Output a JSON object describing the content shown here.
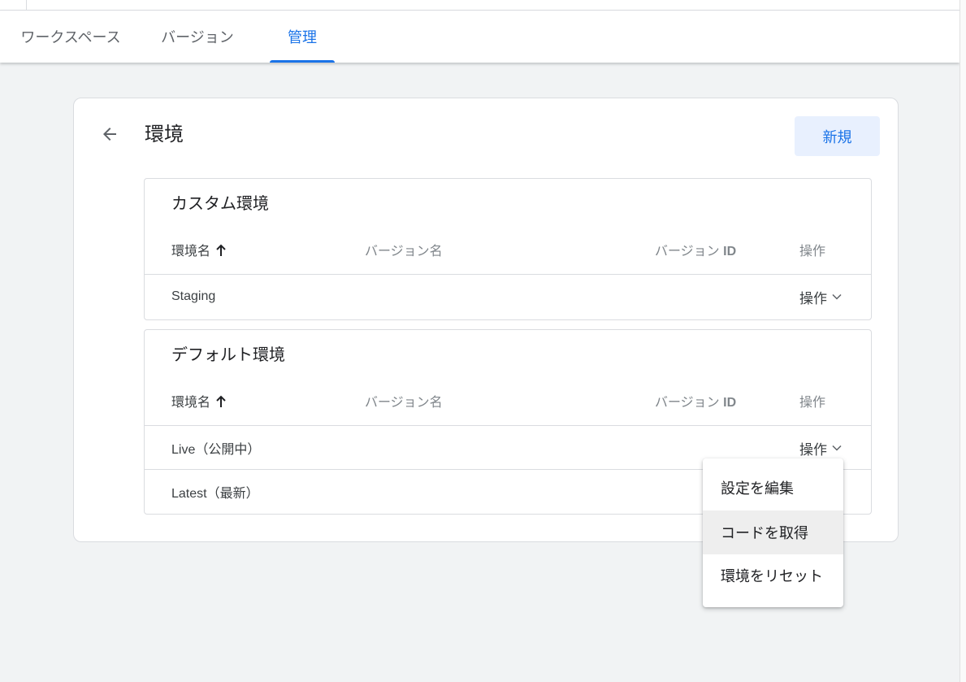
{
  "tabs": [
    {
      "label": "ワークスペース"
    },
    {
      "label": "バージョン"
    },
    {
      "label": "管理",
      "active": true
    }
  ],
  "page": {
    "title": "環境",
    "new_button": "新規"
  },
  "custom_section": {
    "title": "カスタム環境",
    "columns": {
      "name": "環境名",
      "version_name": "バージョン名",
      "version_id_prefix": "バージョン",
      "version_id_suffix": "ID",
      "actions": "操作"
    },
    "rows": [
      {
        "name": "Staging",
        "action": "操作"
      }
    ]
  },
  "default_section": {
    "title": "デフォルト環境",
    "columns": {
      "name": "環境名",
      "version_name": "バージョン名",
      "version_id_prefix": "バージョン",
      "version_id_suffix": "ID",
      "actions": "操作"
    },
    "rows": [
      {
        "name": "Live（公開中）",
        "action": "操作"
      },
      {
        "name": "Latest（最新）"
      }
    ]
  },
  "menu": {
    "items": [
      {
        "label": "設定を編集"
      },
      {
        "label": "コードを取得",
        "highlighted": true
      },
      {
        "label": "環境をリセット"
      }
    ]
  },
  "colors": {
    "accent": "#1a73e8",
    "accent_bg": "#e8f0fe",
    "page_bg": "#f1f3f4",
    "border": "#dadce0"
  }
}
